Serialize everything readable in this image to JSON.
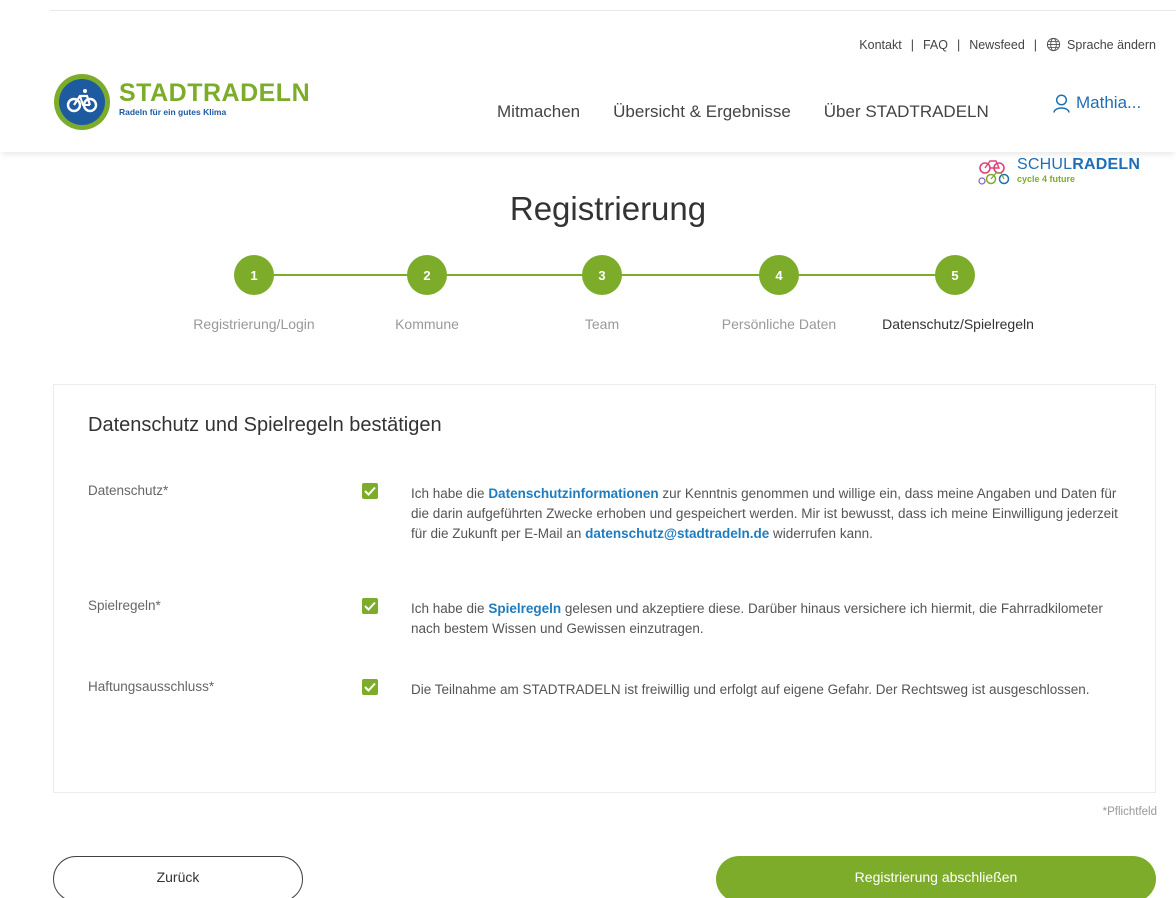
{
  "util_nav": {
    "contact": "Kontakt",
    "faq": "FAQ",
    "newsfeed": "Newsfeed",
    "language": "Sprache ändern",
    "separator": "|"
  },
  "logo": {
    "title": "STADTRADELN",
    "subtitle": "Radeln für ein gutes Klima"
  },
  "main_nav": {
    "items": [
      "Mitmachen",
      "Übersicht & Ergebnisse",
      "Über STADTRADELN"
    ],
    "user": "Mathia..."
  },
  "schulradeln": {
    "title_light": "SCHUL",
    "title_bold": "RADELN",
    "subtitle": "cycle 4 future"
  },
  "page_title": "Registrierung",
  "steps": [
    {
      "number": "1",
      "label": "Registrierung/Login"
    },
    {
      "number": "2",
      "label": "Kommune"
    },
    {
      "number": "3",
      "label": "Team"
    },
    {
      "number": "4",
      "label": "Persönliche Daten"
    },
    {
      "number": "5",
      "label": "Datenschutz/Spielregeln"
    }
  ],
  "form": {
    "title": "Datenschutz und Spielregeln bestätigen",
    "datenschutz": {
      "label": "Datenschutz*",
      "checked": true,
      "text_1": "Ich habe die ",
      "link_1": "Datenschutzinformationen",
      "text_2": " zur Kenntnis genommen und willige ein, dass meine Angaben und Daten für die darin aufgeführten Zwecke erhoben und gespeichert werden. Mir ist bewusst, dass ich meine Einwilligung jederzeit für die Zukunft per E-Mail an ",
      "link_2": "datenschutz@stadtradeln.de",
      "text_3": " widerrufen kann."
    },
    "spielregeln": {
      "label": "Spielregeln*",
      "checked": true,
      "text_1": "Ich habe die ",
      "link": "Spielregeln",
      "text_2": " gelesen und akzeptiere diese. Darüber hinaus versichere ich hiermit, die Fahrradkilometer nach bestem Wissen und Gewissen einzutragen."
    },
    "haftung": {
      "label": "Haftungsausschluss*",
      "checked": true,
      "text": "Die Teilnahme am STADTRADELN ist freiwillig und erfolgt auf eigene Gefahr. Der Rechtsweg ist ausgeschlossen."
    }
  },
  "required_note": "*Pflichtfeld",
  "buttons": {
    "back": "Zurück",
    "submit": "Registrierung abschließen"
  },
  "colors": {
    "brand_green": "#7dac2b",
    "brand_blue": "#1e5aa0",
    "link_blue": "#1e7cc0"
  }
}
